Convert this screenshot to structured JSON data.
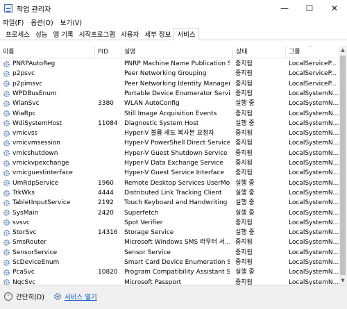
{
  "window": {
    "title": "작업 관리자"
  },
  "menu": [
    "파일(F)",
    "옵션(O)",
    "보기(V)"
  ],
  "tabs": [
    "프로세스",
    "성능",
    "앱 기록",
    "시작프로그램",
    "사용자",
    "세부 정보",
    "서비스"
  ],
  "active_tab": "서비스",
  "columns": {
    "name": "이름",
    "pid": "PID",
    "desc": "설명",
    "status": "상태",
    "group": "그룹"
  },
  "services": [
    {
      "name": "PNRPAutoReg",
      "pid": "",
      "desc": "PNRP Machine Name Publication S...",
      "status": "중지됨",
      "group": "LocalServiceP..."
    },
    {
      "name": "p2psvc",
      "pid": "",
      "desc": "Peer Networking Grouping",
      "status": "중지됨",
      "group": "LocalServiceP..."
    },
    {
      "name": "p2pimsvc",
      "pid": "",
      "desc": "Peer Networking Identity Manager",
      "status": "중지됨",
      "group": "LocalServiceP..."
    },
    {
      "name": "WPDBusEnum",
      "pid": "",
      "desc": "Portable Device Enumerator Service",
      "status": "중지됨",
      "group": "LocalSystemN..."
    },
    {
      "name": "WlanSvc",
      "pid": "3380",
      "desc": "WLAN AutoConfig",
      "status": "실행 중",
      "group": "LocalSystemN..."
    },
    {
      "name": "WiaRpc",
      "pid": "",
      "desc": "Still Image Acquisition Events",
      "status": "중지됨",
      "group": "LocalSystemN..."
    },
    {
      "name": "WdiSystemHost",
      "pid": "11084",
      "desc": "Diagnostic System Host",
      "status": "실행 중",
      "group": "LocalSystemN..."
    },
    {
      "name": "vmicvss",
      "pid": "",
      "desc": "Hyper-V 볼륨 섀도 복사본 요청자",
      "status": "중지됨",
      "group": "LocalSystemN..."
    },
    {
      "name": "vmicvmsession",
      "pid": "",
      "desc": "Hyper-V PowerShell Direct Service",
      "status": "중지됨",
      "group": "LocalSystemN..."
    },
    {
      "name": "vmicshutdown",
      "pid": "",
      "desc": "Hyper-V Guest Shutdown Service",
      "status": "중지됨",
      "group": "LocalSystemN..."
    },
    {
      "name": "vmickvpexchange",
      "pid": "",
      "desc": "Hyper-V Data Exchange Service",
      "status": "중지됨",
      "group": "LocalSystemN..."
    },
    {
      "name": "vmicguestinterface",
      "pid": "",
      "desc": "Hyper-V Guest Service Interface",
      "status": "중지됨",
      "group": "LocalSystemN..."
    },
    {
      "name": "UmRdpService",
      "pid": "1960",
      "desc": "Remote Desktop Services UserMod...",
      "status": "실행 중",
      "group": "LocalSystemN..."
    },
    {
      "name": "TrkWks",
      "pid": "4444",
      "desc": "Distributed Link Tracking Client",
      "status": "실행 중",
      "group": "LocalSystemN..."
    },
    {
      "name": "TabletInputService",
      "pid": "2192",
      "desc": "Touch Keyboard and Handwriting P...",
      "status": "실행 중",
      "group": "LocalSystemN..."
    },
    {
      "name": "SysMain",
      "pid": "2420",
      "desc": "Superfetch",
      "status": "실행 중",
      "group": "LocalSystemN..."
    },
    {
      "name": "svsvc",
      "pid": "",
      "desc": "Spot Verifier",
      "status": "중지됨",
      "group": "LocalSystemN..."
    },
    {
      "name": "StorSvc",
      "pid": "14316",
      "desc": "Storage Service",
      "status": "실행 중",
      "group": "LocalSystemN..."
    },
    {
      "name": "SmsRouter",
      "pid": "",
      "desc": "Microsoft Windows SMS 라우터 서...",
      "status": "중지됨",
      "group": "LocalSystemN..."
    },
    {
      "name": "SensorService",
      "pid": "",
      "desc": "Sensor Service",
      "status": "중지됨",
      "group": "LocalSystemN..."
    },
    {
      "name": "ScDeviceEnum",
      "pid": "",
      "desc": "Smart Card Device Enumeration Se...",
      "status": "중지됨",
      "group": "LocalSystemN..."
    },
    {
      "name": "PcaSvc",
      "pid": "10820",
      "desc": "Program Compatibility Assistant Se...",
      "status": "실행 중",
      "group": "LocalSystemN..."
    },
    {
      "name": "NgcSvc",
      "pid": "",
      "desc": "Microsoft Passport",
      "status": "중지됨",
      "group": "LocalSystemN..."
    }
  ],
  "footer": {
    "fewer_details": "간단히(D)",
    "open_services": "서비스 열기"
  },
  "colors": {
    "link": "#0050c0",
    "icon_gear": "#5a7fb5",
    "scrollbar_thumb": "#c1c1c1"
  }
}
